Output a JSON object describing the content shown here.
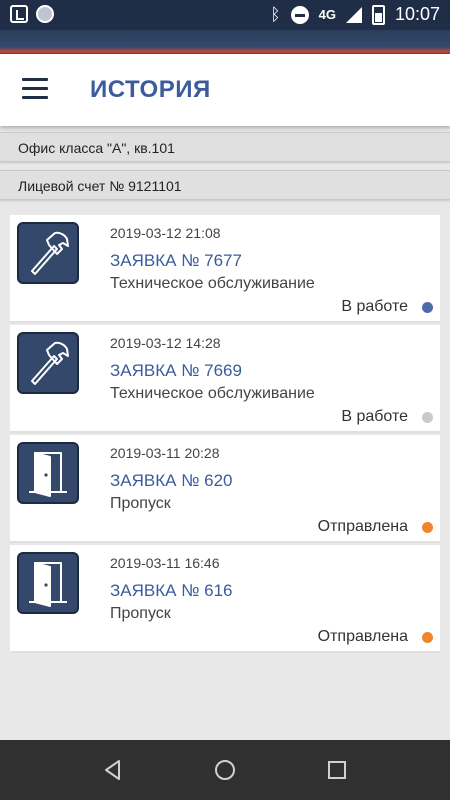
{
  "status_bar": {
    "network": "4G",
    "time": "10:07"
  },
  "header": {
    "title": "ИСТОРИЯ"
  },
  "info": {
    "office": "Офис класса \"А\", кв.101",
    "account": "Лицевой счет № 9121101"
  },
  "requests": [
    {
      "date": "2019-03-12 21:08",
      "number": "ЗАЯВКА № 7677",
      "type": "Техническое обслуживание",
      "status": "В работе",
      "status_color": "#4f6aa8",
      "icon": "hammer-icon"
    },
    {
      "date": "2019-03-12 14:28",
      "number": "ЗАЯВКА № 7669",
      "type": "Техническое обслуживание",
      "status": "В работе",
      "status_color": "#c9c9c9",
      "icon": "hammer-icon"
    },
    {
      "date": "2019-03-11 20:28",
      "number": "ЗАЯВКА № 620",
      "type": "Пропуск",
      "status": "Отправлена",
      "status_color": "#f0852b",
      "icon": "door-icon"
    },
    {
      "date": "2019-03-11 16:46",
      "number": "ЗАЯВКА № 616",
      "type": "Пропуск",
      "status": "Отправлена",
      "status_color": "#f0852b",
      "icon": "door-icon"
    }
  ],
  "colors": {
    "accent": "#3b5c9c",
    "status_bar": "#1f2e46",
    "icon_bg": "#34486b",
    "nav_bar": "#303030"
  }
}
